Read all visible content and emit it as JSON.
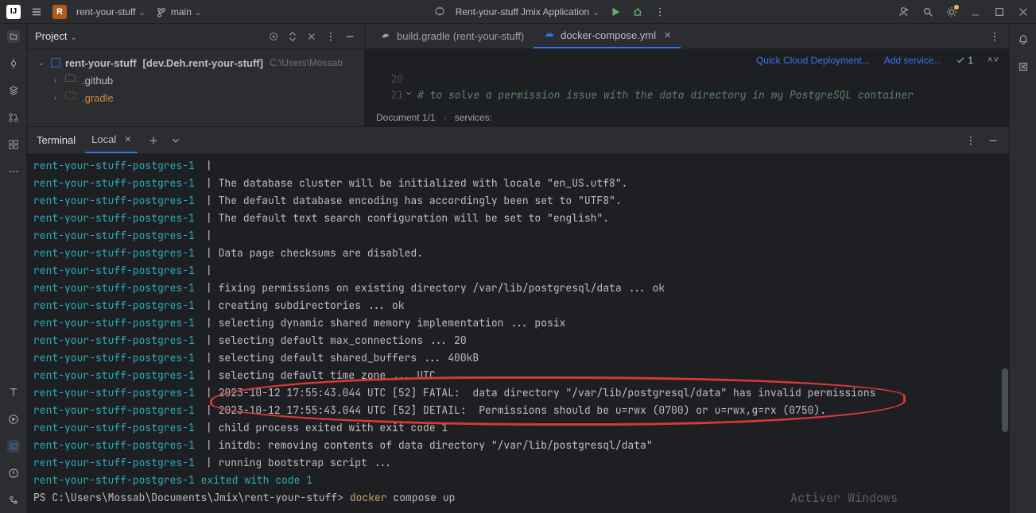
{
  "topbar": {
    "project_letter": "R",
    "project_name": "rent-your-stuff",
    "branch": "main",
    "run_config": "Rent-your-stuff Jmix Application"
  },
  "project_pane": {
    "title": "Project",
    "root_name": "rent-your-stuff",
    "root_qual": "[dev.Deh.rent-your-stuff]",
    "root_path": "C:\\Users\\Mossab",
    "child_github": ".github",
    "child_gradle": ".gradle"
  },
  "editor": {
    "tab1": "build.gradle (rent-your-stuff)",
    "tab2": "docker-compose.yml",
    "link_cloud": "Quick Cloud Deployment...",
    "link_service": "Add service...",
    "check_count": "1",
    "gutter": {
      "l20": "20",
      "l21": "21"
    },
    "comment": "# to solve a permission issue with the data directory in my PostgreSQL container",
    "crumb1": "Document 1/1",
    "crumb2": "services:"
  },
  "terminal": {
    "title": "Terminal",
    "tab": "Local",
    "container": "rent-your-stuff-postgres-1",
    "sep": "|",
    "lines": [
      "",
      "The database cluster will be initialized with locale \"en_US.utf8\".",
      "The default database encoding has accordingly been set to \"UTF8\".",
      "The default text search configuration will be set to \"english\".",
      "",
      "Data page checksums are disabled.",
      "",
      "fixing permissions on existing directory /var/lib/postgresql/data ... ok",
      "creating subdirectories ... ok",
      "selecting dynamic shared memory implementation ... posix",
      "selecting default max_connections ... 20",
      "selecting default shared_buffers ... 400kB",
      "selecting default time zone ... UTC",
      "2023-10-12 17:55:43.044 UTC [52] FATAL:  data directory \"/var/lib/postgresql/data\" has invalid permissions",
      "2023-10-12 17:55:43.044 UTC [52] DETAIL:  Permissions should be u=rwx (0700) or u=rwx,g=rx (0750).",
      "child process exited with exit code 1",
      "initdb: removing contents of data directory \"/var/lib/postgresql/data\"",
      "running bootstrap script ..."
    ],
    "exit_line": "rent-your-stuff-postgres-1 exited with code 1",
    "prompt_prefix": "PS C:\\Users\\Mossab\\Documents\\Jmix\\rent-your-stuff> ",
    "prompt_cmd": "docker",
    "prompt_args": " compose up"
  },
  "watermark": "Activer Windows"
}
